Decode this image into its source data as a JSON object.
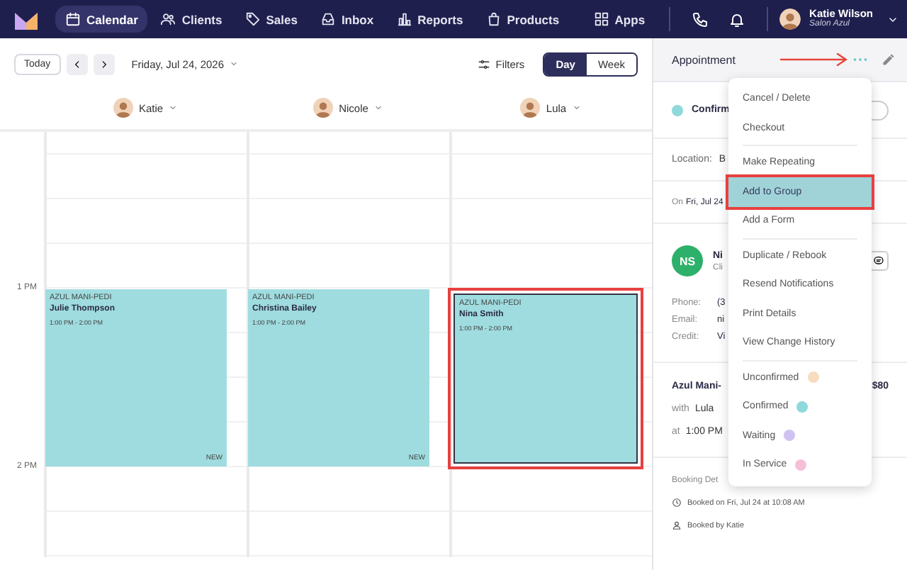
{
  "nav": {
    "items": [
      {
        "label": "Calendar",
        "kind": "calendar",
        "selected": true
      },
      {
        "label": "Clients",
        "kind": "people",
        "selected": false
      },
      {
        "label": "Sales",
        "kind": "tag",
        "selected": false
      },
      {
        "label": "Inbox",
        "kind": "inbox",
        "selected": false
      },
      {
        "label": "Reports",
        "kind": "chart",
        "selected": false
      },
      {
        "label": "Products",
        "kind": "bag",
        "selected": false
      }
    ],
    "apps": "Apps",
    "user": {
      "name": "Katie Wilson",
      "salon": "Salon Azul"
    }
  },
  "toolbar": {
    "today": "Today",
    "date": "Friday, Jul 24, 2026",
    "filters": "Filters",
    "views": [
      {
        "label": "Day",
        "selected": true
      },
      {
        "label": "Week",
        "selected": false
      }
    ]
  },
  "staff": [
    {
      "name": "Katie"
    },
    {
      "name": "Nicole"
    },
    {
      "name": "Lula"
    }
  ],
  "hours": [
    "1 PM",
    "2 PM"
  ],
  "appointments": [
    {
      "service": "AZUL MANI-PEDI",
      "client": "Julie Thompson",
      "time": "1:00 PM - 2:00 PM",
      "badge": "NEW",
      "selected": false
    },
    {
      "service": "AZUL MANI-PEDI",
      "client": "Christina Bailey",
      "time": "1:00 PM - 2:00 PM",
      "badge": "NEW",
      "selected": false
    },
    {
      "service": "AZUL MANI-PEDI",
      "client": "Nina Smith",
      "time": "1:00 PM - 2:00 PM",
      "selected": true
    }
  ],
  "panel": {
    "title": "Appointment",
    "status": "Confirm",
    "location_label": "Location:",
    "location_value": "B",
    "date_prefix": "On",
    "date_value": "Fri, Jul 24",
    "client": {
      "initials": "NS",
      "name": "Ni",
      "subtitle": "Cli"
    },
    "contacts": [
      {
        "label": "Phone:",
        "value": "(3"
      },
      {
        "label": "Email:",
        "value": "ni"
      },
      {
        "label": "Credit:",
        "value": "Vi"
      }
    ],
    "service": {
      "name": "Azul Mani-",
      "price": "$80",
      "with_label": "with",
      "staff": "Lula",
      "at_label": "at",
      "time": "1:00 PM"
    },
    "booking": {
      "title": "Booking Det",
      "items": [
        {
          "kind": "clock",
          "text": "Booked on Fri, Jul 24 at 10:08 AM"
        },
        {
          "kind": "person",
          "text": "Booked by Katie"
        }
      ]
    }
  },
  "menu": {
    "groups": [
      [
        {
          "label": "Cancel / Delete",
          "selected": false
        },
        {
          "label": "Checkout",
          "selected": false
        }
      ],
      [
        {
          "label": "Make Repeating",
          "selected": false
        },
        {
          "label": "Add to Group",
          "selected": true
        },
        {
          "label": "Add a Form",
          "selected": false
        }
      ],
      [
        {
          "label": "Duplicate / Rebook",
          "selected": false
        },
        {
          "label": "Resend Notifications",
          "selected": false
        },
        {
          "label": "Print Details",
          "selected": false
        },
        {
          "label": "View Change History",
          "selected": false
        }
      ],
      [
        {
          "label": "Unconfirmed",
          "selected": false,
          "color": "#f8dcc0"
        },
        {
          "label": "Confirmed",
          "selected": false,
          "color": "#8fd8dc"
        },
        {
          "label": "Waiting",
          "selected": false,
          "color": "#cfc2f2"
        },
        {
          "label": "In Service",
          "selected": false,
          "color": "#f6bfd8"
        }
      ]
    ]
  }
}
